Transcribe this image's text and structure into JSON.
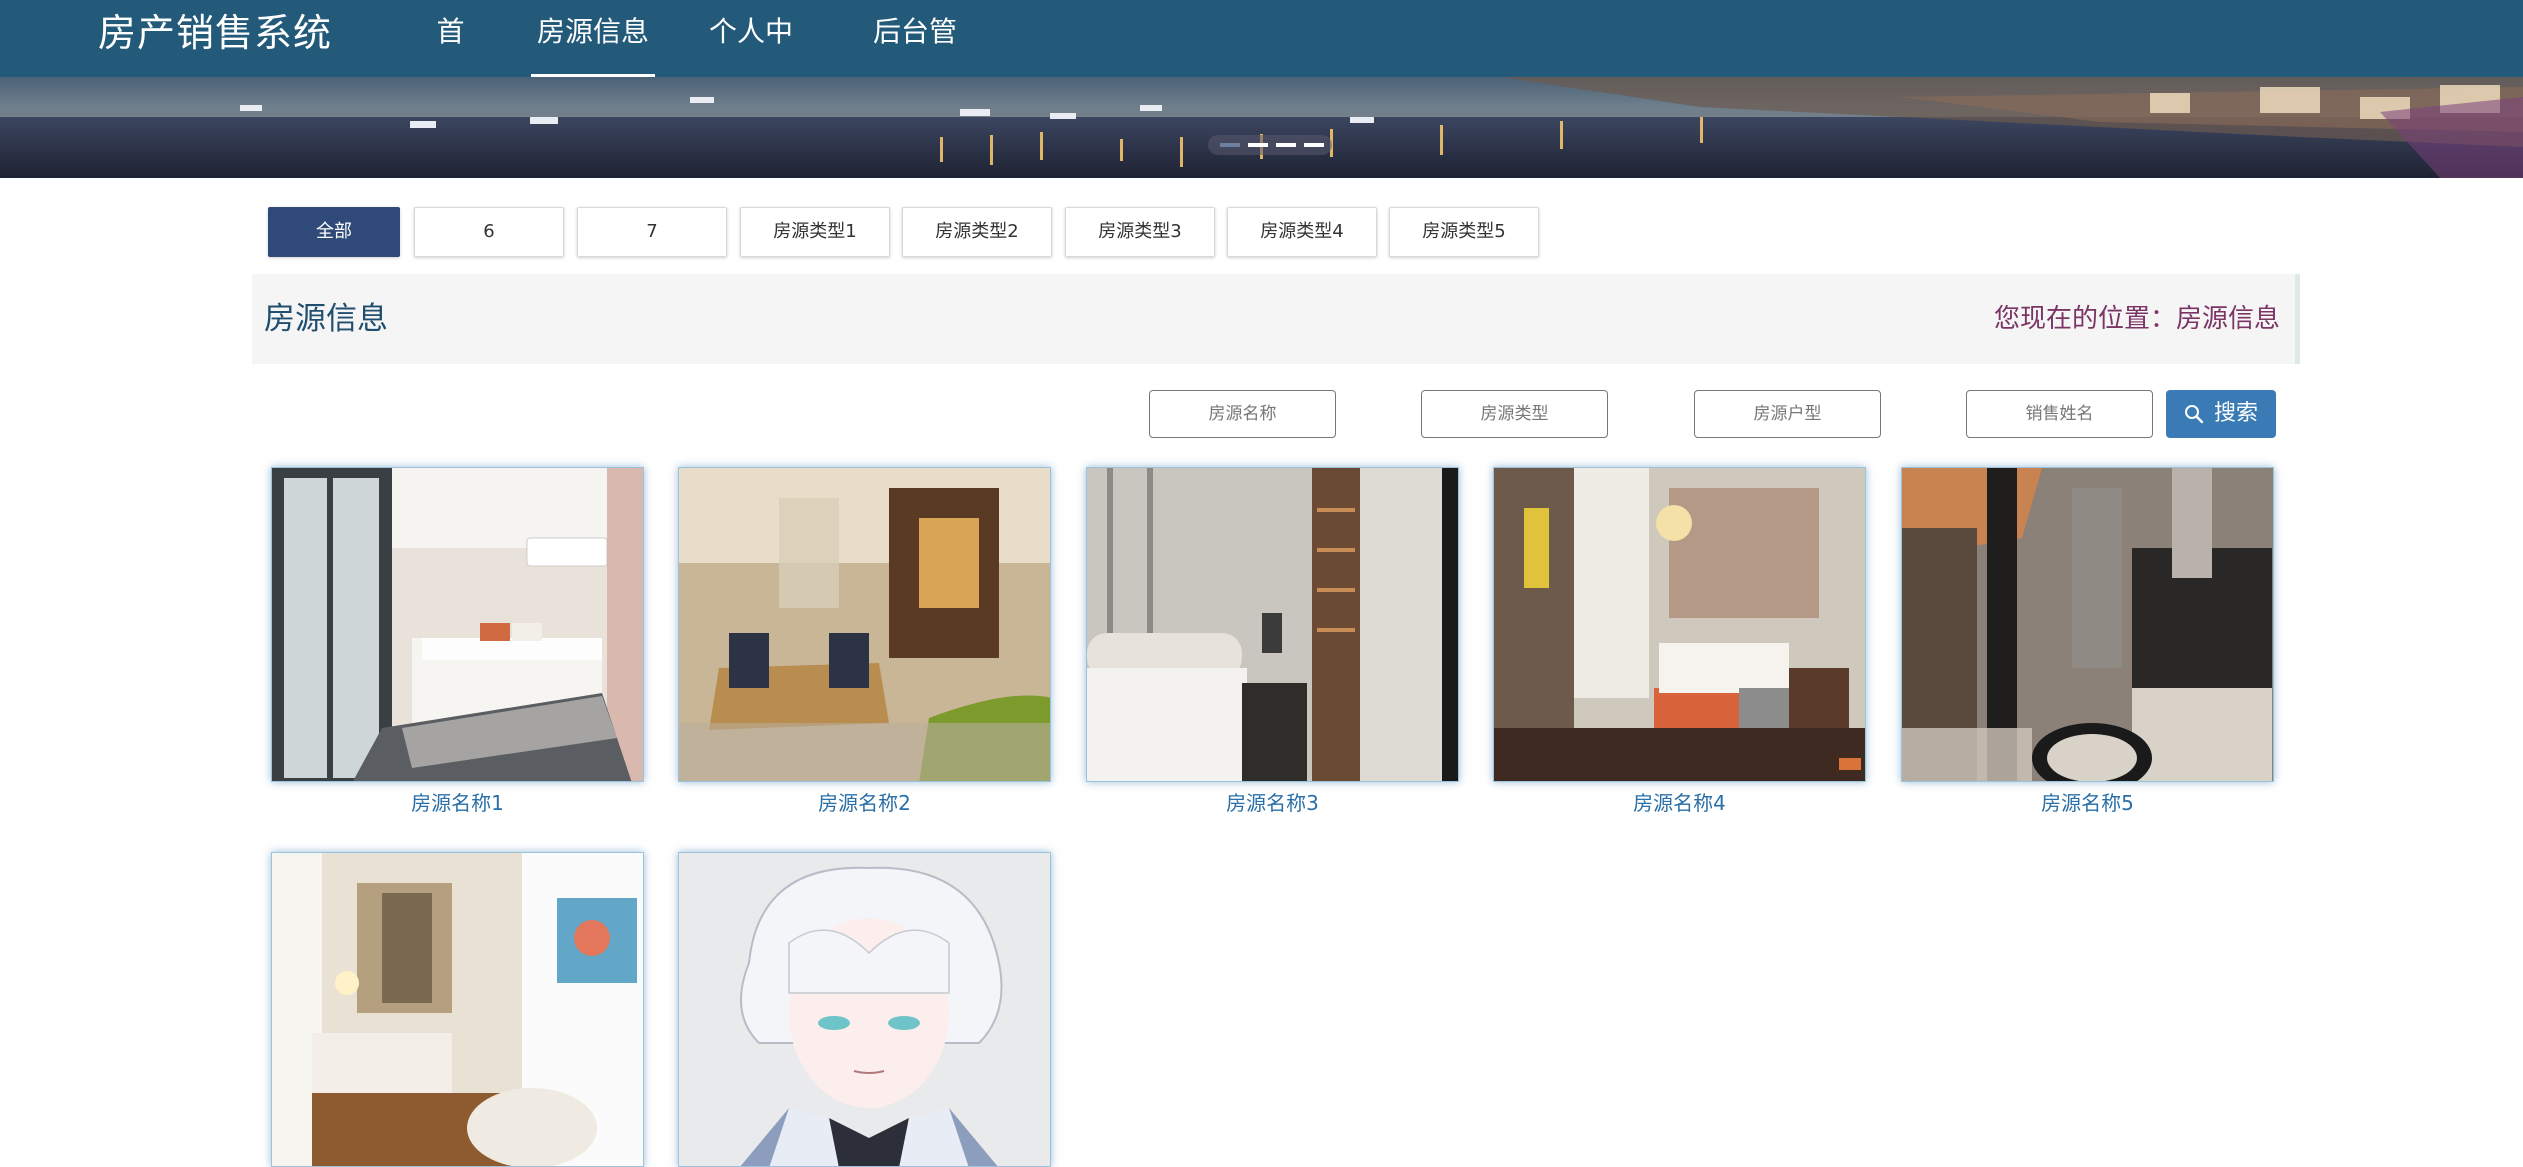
{
  "brand": "房产销售系统",
  "nav": [
    {
      "label": "首页",
      "active": false
    },
    {
      "label": "房源信息",
      "active": true
    },
    {
      "label": "个人中心",
      "active": false
    },
    {
      "label": "后台管理",
      "active": false
    }
  ],
  "banner": {
    "slides": 4,
    "active_slide": 1
  },
  "categories": [
    {
      "label": "全部",
      "active": true
    },
    {
      "label": "6"
    },
    {
      "label": "7"
    },
    {
      "label": "房源类型1"
    },
    {
      "label": "房源类型2"
    },
    {
      "label": "房源类型3"
    },
    {
      "label": "房源类型4"
    },
    {
      "label": "房源类型5"
    }
  ],
  "section": {
    "title": "房源信息",
    "breadcrumb": "您现在的位置：房源信息"
  },
  "search": {
    "name_placeholder": "房源名称",
    "type_placeholder": "房源类型",
    "layout_placeholder": "房源户型",
    "seller_placeholder": "销售姓名",
    "button_label": "搜索",
    "button_icon": "search-icon"
  },
  "houses": [
    {
      "name": "房源名称1"
    },
    {
      "name": "房源名称2"
    },
    {
      "name": "房源名称3"
    },
    {
      "name": "房源名称4"
    },
    {
      "name": "房源名称5"
    },
    {
      "name": ""
    },
    {
      "name": ""
    }
  ],
  "colors": {
    "nav_bg": "#235a7a",
    "active_tab": "#2f4a78",
    "search_button": "#3a7bb5",
    "link": "#2a6fa7",
    "breadcrumb": "#7a3565"
  }
}
